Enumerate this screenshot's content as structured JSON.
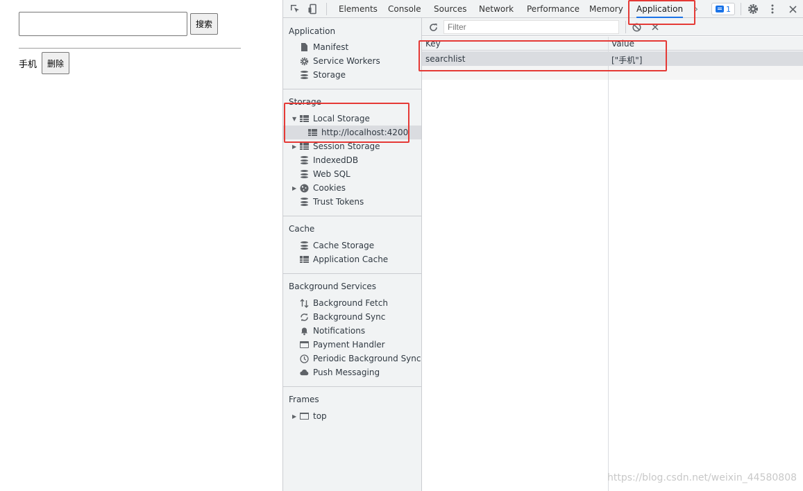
{
  "page": {
    "search_button": "搜索",
    "history_item": "手机",
    "delete_button": "删除"
  },
  "devtools": {
    "tabs": [
      "Elements",
      "Console",
      "Sources",
      "Network",
      "Performance",
      "Memory",
      "Application"
    ],
    "active_tab": "Application",
    "issues_count": "1",
    "filter_placeholder": "Filter",
    "sidebar": {
      "application": {
        "title": "Application",
        "items": [
          "Manifest",
          "Service Workers",
          "Storage"
        ]
      },
      "storage": {
        "title": "Storage",
        "items": [
          "Local Storage",
          "http://localhost:4200",
          "Session Storage",
          "IndexedDB",
          "Web SQL",
          "Cookies",
          "Trust Tokens"
        ]
      },
      "cache": {
        "title": "Cache",
        "items": [
          "Cache Storage",
          "Application Cache"
        ]
      },
      "background": {
        "title": "Background Services",
        "items": [
          "Background Fetch",
          "Background Sync",
          "Notifications",
          "Payment Handler",
          "Periodic Background Sync",
          "Push Messaging"
        ]
      },
      "frames": {
        "title": "Frames",
        "items": [
          "top"
        ]
      }
    },
    "table": {
      "headers": [
        "Key",
        "Value"
      ],
      "rows": [
        {
          "key": "searchlist",
          "value": "[\"手机\"]"
        }
      ]
    }
  },
  "watermark": "https://blog.csdn.net/weixin_44580808",
  "colors": {
    "accent": "#1a73e8",
    "annotation": "#e53935",
    "selected": "#dadce0",
    "panel": "#f1f3f4"
  }
}
